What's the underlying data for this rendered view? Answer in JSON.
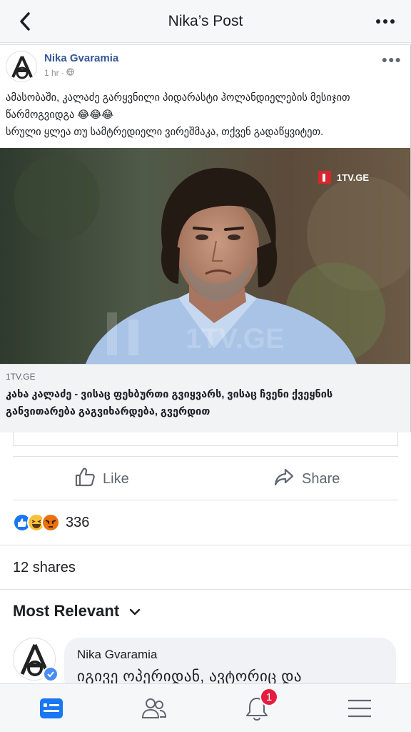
{
  "header": {
    "title": "Nika’s Post",
    "back_icon": "chevron-left-icon",
    "more_icon": "more-dots-icon"
  },
  "shared_post": {
    "author": "Nika Gvaramia",
    "time": "1 hr",
    "privacy_icon": "globe-icon",
    "text_lines": [
      "ამასობაში, კალაძე გარყვნილი პიდარასტი ჰოლანდიელების მესიჯით",
      "წარმოგვიდგა 😂😂😂",
      "სრული ყლეა თუ სამტრედიელი ვირეშმაკა, თქვენ გადაწყვიტეთ."
    ],
    "photo_watermark": "1TV.GE",
    "photo_bg_watermark": "1TV.GE",
    "link_domain": "1TV.GE",
    "link_headline": "კახა კალაძე - ვისაც ფეხბურთი გვიყვარს, ვისაც ჩვენი ქვეყნის განვითარება გაგვიხარდება, გვერდით"
  },
  "actions": {
    "like_label": "Like",
    "share_label": "Share"
  },
  "reactions": {
    "count": "336",
    "types": [
      "like",
      "haha",
      "angry"
    ]
  },
  "shares_text": "12 shares",
  "sort": {
    "label": "Most Relevant"
  },
  "comment": {
    "author": "Nika Gvaramia",
    "text": "იგივე ოპერიდან, ავტორიც და"
  },
  "tabbar": {
    "tabs": [
      "news-feed-icon",
      "friends-icon",
      "notifications-icon",
      "menu-icon"
    ],
    "notifications_badge": "1"
  },
  "colors": {
    "link_blue": "#365899",
    "fb_blue": "#1877f2",
    "badge_red": "#e41e3f"
  }
}
